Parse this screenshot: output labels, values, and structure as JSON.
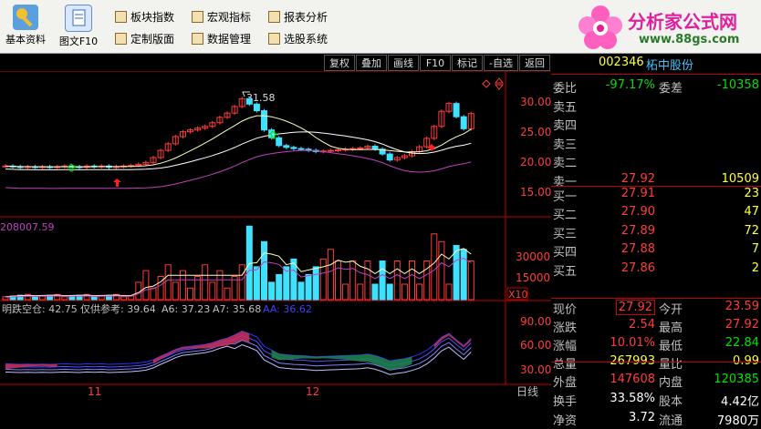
{
  "toolbar": {
    "big_buttons": [
      {
        "label": "基本资料",
        "icon": "key-icon"
      },
      {
        "label": "图文F10",
        "icon": "document-icon"
      }
    ],
    "buttons": [
      {
        "label": "板块指数"
      },
      {
        "label": "宏观指标"
      },
      {
        "label": "报表分析"
      },
      {
        "label": "定制版面"
      },
      {
        "label": "数据管理"
      },
      {
        "label": "选股系统"
      }
    ],
    "logo": {
      "text": "分析家公式网",
      "url": "www.88gs.com"
    }
  },
  "chart_tools": [
    "复权",
    "叠加",
    "画线",
    "F10",
    "标记",
    "-自选",
    "返回"
  ],
  "stock": {
    "code": "002346",
    "name": "柘中股份"
  },
  "panel": {
    "weibi_label": "委比",
    "weibi": "-97.17%",
    "weicha_label": "委差",
    "weicha": "-10358",
    "asks": [
      {
        "label": "卖五",
        "price": "",
        "vol": ""
      },
      {
        "label": "卖四",
        "price": "",
        "vol": ""
      },
      {
        "label": "卖三",
        "price": "",
        "vol": ""
      },
      {
        "label": "卖二",
        "price": "",
        "vol": ""
      },
      {
        "label": "卖一",
        "price": "27.92",
        "vol": "10509"
      }
    ],
    "bids": [
      {
        "label": "买一",
        "price": "27.91",
        "vol": "23"
      },
      {
        "label": "买二",
        "price": "27.90",
        "vol": "47"
      },
      {
        "label": "买三",
        "price": "27.89",
        "vol": "72"
      },
      {
        "label": "买四",
        "price": "27.88",
        "vol": "7"
      },
      {
        "label": "买五",
        "price": "27.86",
        "vol": "2"
      }
    ],
    "stats": [
      {
        "l1": "现价",
        "v1": "27.92",
        "l2": "今开",
        "v2": "23.59"
      },
      {
        "l1": "涨跌",
        "v1": "2.54",
        "l2": "最高",
        "v2": "27.92"
      },
      {
        "l1": "涨幅",
        "v1": "10.01%",
        "l2": "最低",
        "v2": "22.84"
      },
      {
        "l1": "总量",
        "v1": "267993",
        "l2": "量比",
        "v2": "0.99"
      },
      {
        "l1": "外盘",
        "v1": "147608",
        "l2": "内盘",
        "v2": "120385"
      },
      {
        "l1": "换手",
        "v1": "33.58%",
        "l2": "股本",
        "v2": "4.42亿"
      },
      {
        "l1": "净资",
        "v1": "3.72",
        "l2": "流通",
        "v2": "7980万"
      }
    ]
  },
  "price_axis": [
    "30.00",
    "25.00",
    "20.00",
    "15.00"
  ],
  "max_label": "31.58",
  "volume_axis": [
    "30000",
    "15000"
  ],
  "volume_unit": "X10",
  "volume_title": "208007.59",
  "osc_axis": [
    "90.00",
    "60.00",
    "30.00"
  ],
  "osc_legend": [
    {
      "text": "明跌空仓: 42.75",
      "color": "#c0c0c0"
    },
    {
      "text": "仅供参考: 39.64",
      "color": "#c0c0c0"
    },
    {
      "text": "A6: 37.23",
      "color": "#c0c0c0"
    },
    {
      "text": "A7: 35.68",
      "color": "#c0c0c0"
    },
    {
      "text": "AA: 36.62",
      "color": "#4040ff"
    }
  ],
  "x_labels": [
    "11",
    "12"
  ],
  "period": "日线",
  "colors": {
    "up": "#ff3b3b",
    "down": "#40e0ff",
    "ma1": "#ffffc0",
    "ma2": "#ffffff",
    "band": "#c040c0"
  }
}
